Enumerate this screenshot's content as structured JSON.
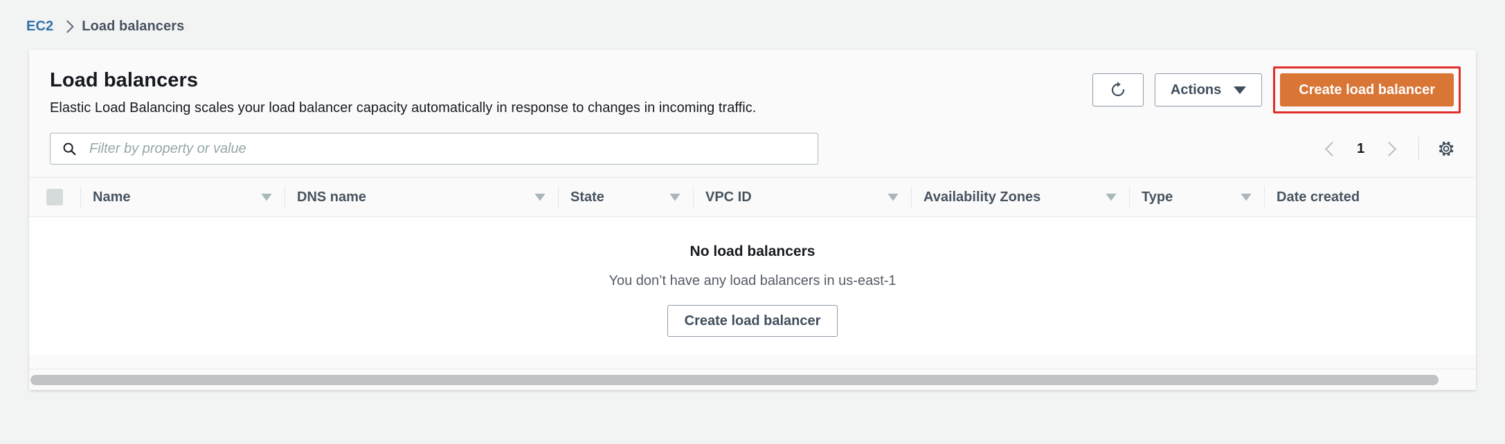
{
  "breadcrumb": {
    "root": "EC2",
    "current": "Load balancers"
  },
  "panel": {
    "title": "Load balancers",
    "description": "Elastic Load Balancing scales your load balancer capacity automatically in response to changes in incoming traffic.",
    "actions": {
      "refresh_icon": "refresh-icon",
      "actions_label": "Actions",
      "create_label": "Create load balancer"
    }
  },
  "filter": {
    "placeholder": "Filter by property or value",
    "value": "",
    "search_icon": "search-icon"
  },
  "pagination": {
    "prev_icon": "chevron-left-icon",
    "page": "1",
    "next_icon": "chevron-right-icon",
    "settings_icon": "gear-icon"
  },
  "table": {
    "columns": [
      {
        "label": "Name",
        "sortable": true
      },
      {
        "label": "DNS name",
        "sortable": true
      },
      {
        "label": "State",
        "sortable": true
      },
      {
        "label": "VPC ID",
        "sortable": true
      },
      {
        "label": "Availability Zones",
        "sortable": true
      },
      {
        "label": "Type",
        "sortable": true
      },
      {
        "label": "Date created",
        "sortable": false
      }
    ],
    "rows": []
  },
  "empty_state": {
    "title": "No load balancers",
    "description": "You don’t have any load balancers in us-east-1",
    "button_label": "Create load balancer"
  },
  "colors": {
    "page_background": "#f2f3f3",
    "card_background": "#fafafa",
    "link": "#2f72ad",
    "primary_button": "#d97535",
    "annotation_outline": "#e02f27",
    "text": "#16191f",
    "muted_text": "#545b64"
  }
}
